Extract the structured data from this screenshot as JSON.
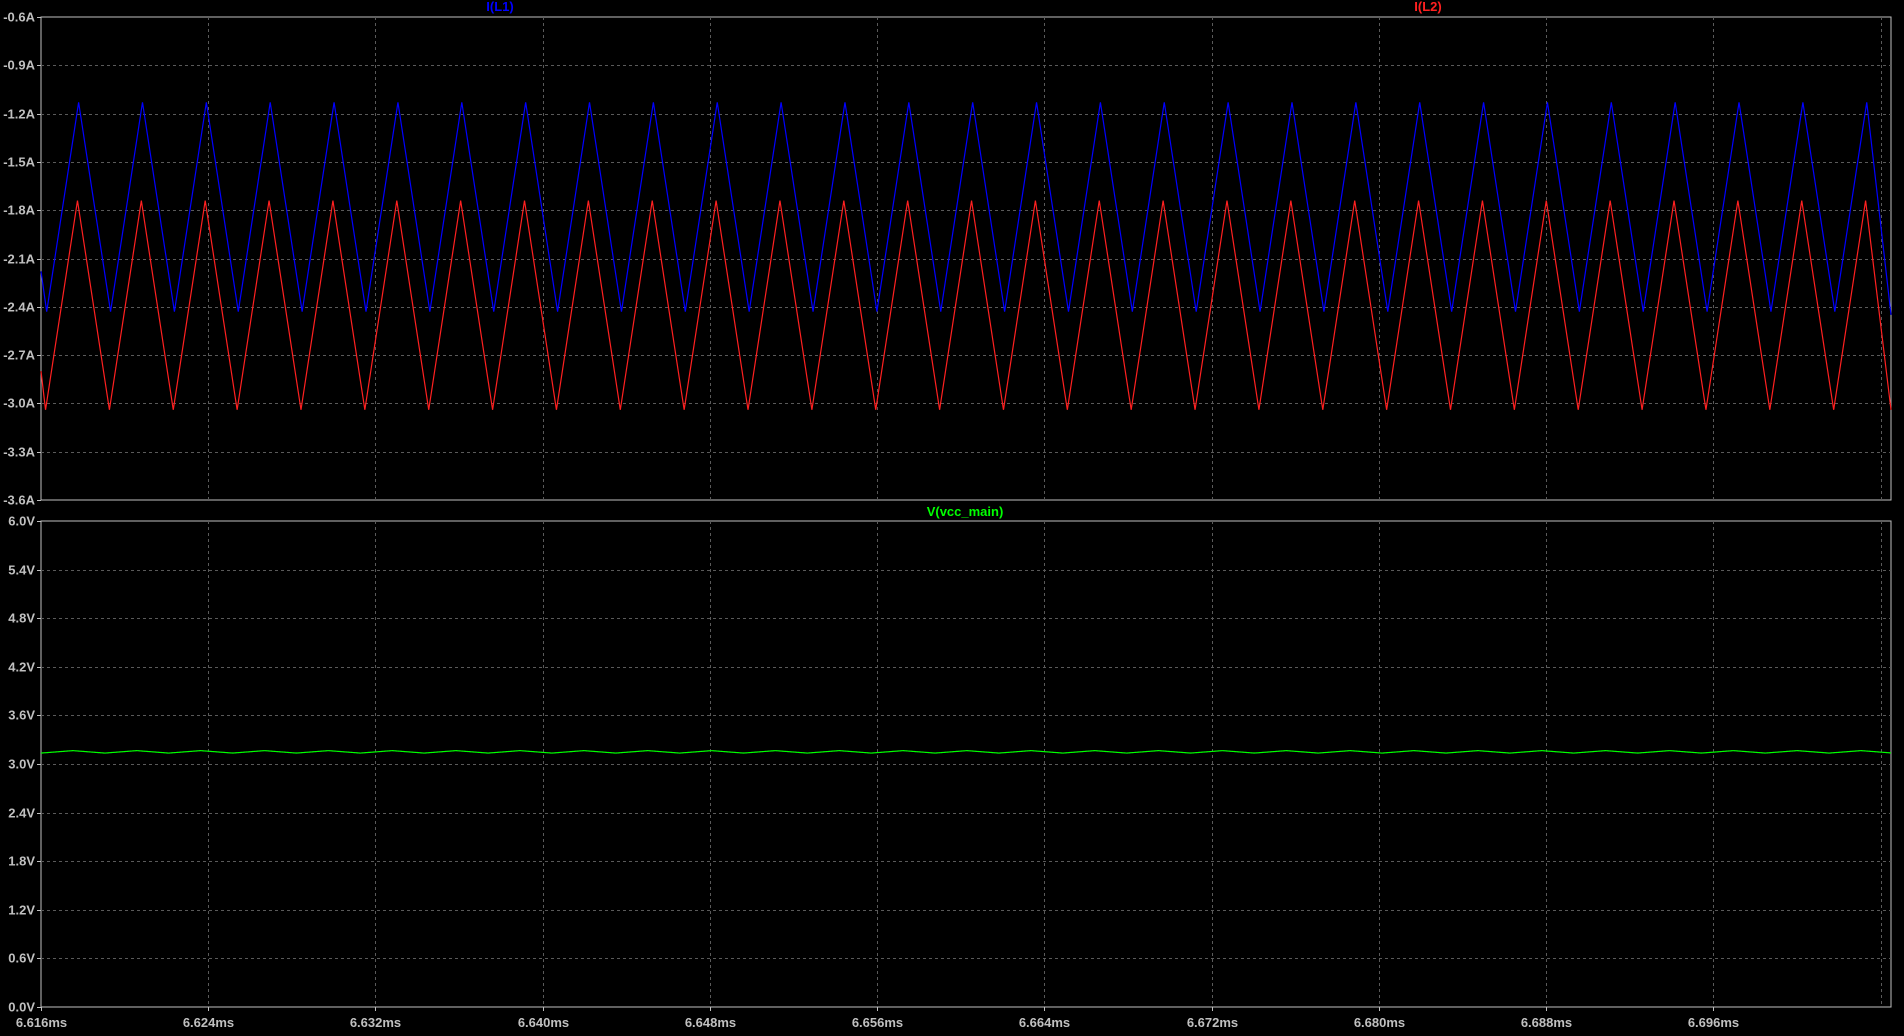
{
  "window": {
    "background": "#000000",
    "grid_color": "#5a5a5a",
    "frame_color": "#bfbfbf",
    "tick_label_color": "#c0c0c0"
  },
  "chart_data": [
    {
      "type": "line",
      "title": "",
      "xlabel": "",
      "ylabel": "",
      "grid": true,
      "xlim": [
        6.616,
        6.7045
      ],
      "ylim": [
        -3.6,
        -0.6
      ],
      "x_unit": "ms",
      "y_ticks": [
        "-0.6A",
        "-0.9A",
        "-1.2A",
        "-1.5A",
        "-1.8A",
        "-2.1A",
        "-2.4A",
        "-2.7A",
        "-3.0A",
        "-3.3A",
        "-3.6A"
      ],
      "y_tick_values": [
        -0.6,
        -0.9,
        -1.2,
        -1.5,
        -1.8,
        -2.1,
        -2.4,
        -2.7,
        -3.0,
        -3.3,
        -3.6
      ],
      "series": [
        {
          "name": "I(L1)",
          "color": "#0000ff",
          "waveform": "triangle",
          "max": -1.13,
          "min": -2.43,
          "period_ms": 0.003055,
          "first_peak_ms": 6.6178,
          "start_value": -2.18,
          "end_value": -2.45
        },
        {
          "name": "I(L2)",
          "color": "#ff2020",
          "waveform": "triangle",
          "max": -1.74,
          "min": -3.04,
          "period_ms": 0.003055,
          "first_peak_ms": 6.6208,
          "start_value": -2.8,
          "end_value": -3.04
        }
      ]
    },
    {
      "type": "line",
      "title": "",
      "xlabel": "",
      "ylabel": "",
      "grid": true,
      "xlim": [
        6.616,
        6.7045
      ],
      "ylim": [
        0.0,
        6.0
      ],
      "x_unit": "ms",
      "x_ticks": [
        "6.616ms",
        "6.624ms",
        "6.632ms",
        "6.640ms",
        "6.648ms",
        "6.656ms",
        "6.664ms",
        "6.672ms",
        "6.680ms",
        "6.688ms",
        "6.696ms"
      ],
      "x_tick_values": [
        6.616,
        6.624,
        6.632,
        6.64,
        6.648,
        6.656,
        6.664,
        6.672,
        6.68,
        6.688,
        6.696
      ],
      "y_ticks": [
        "6.0V",
        "5.4V",
        "4.8V",
        "4.2V",
        "3.6V",
        "3.0V",
        "2.4V",
        "1.8V",
        "1.2V",
        "0.6V",
        "0.0V"
      ],
      "y_tick_values": [
        6.0,
        5.4,
        4.8,
        4.2,
        3.6,
        3.0,
        2.4,
        1.8,
        1.2,
        0.6,
        0.0
      ],
      "series": [
        {
          "name": "V(vcc_main)",
          "color": "#00ff00",
          "waveform": "ripple",
          "mean": 3.15,
          "ripple_pp": 0.03,
          "period_ms": 0.003055
        }
      ]
    }
  ]
}
